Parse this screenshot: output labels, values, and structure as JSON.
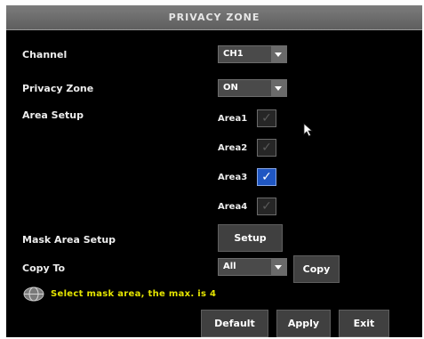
{
  "dialog": {
    "title": "PRIVACY ZONE"
  },
  "form": {
    "channel": {
      "label": "Channel",
      "value": "CH1"
    },
    "privacy_zone": {
      "label": "Privacy Zone",
      "value": "ON"
    },
    "area_setup": {
      "label": "Area Setup",
      "areas": [
        {
          "label": "Area1",
          "checked": false
        },
        {
          "label": "Area2",
          "checked": false
        },
        {
          "label": "Area3",
          "checked": true
        },
        {
          "label": "Area4",
          "checked": false
        }
      ]
    },
    "mask_area_setup": {
      "label": "Mask Area Setup",
      "button": "Setup"
    },
    "copy_to": {
      "label": "Copy To",
      "value": "All",
      "button": "Copy"
    }
  },
  "hint": "Select mask area, the max.  is 4",
  "footer": {
    "default": "Default",
    "apply": "Apply",
    "exit": "Exit"
  },
  "colors": {
    "accent": "#1f56c2",
    "hint": "#e4e400",
    "title_bar": "#6b6b6b"
  },
  "icons": {
    "hint": "globe-info-icon",
    "check": "check-icon",
    "dropdown": "chevron-down-icon",
    "cursor": "mouse-pointer-icon"
  }
}
